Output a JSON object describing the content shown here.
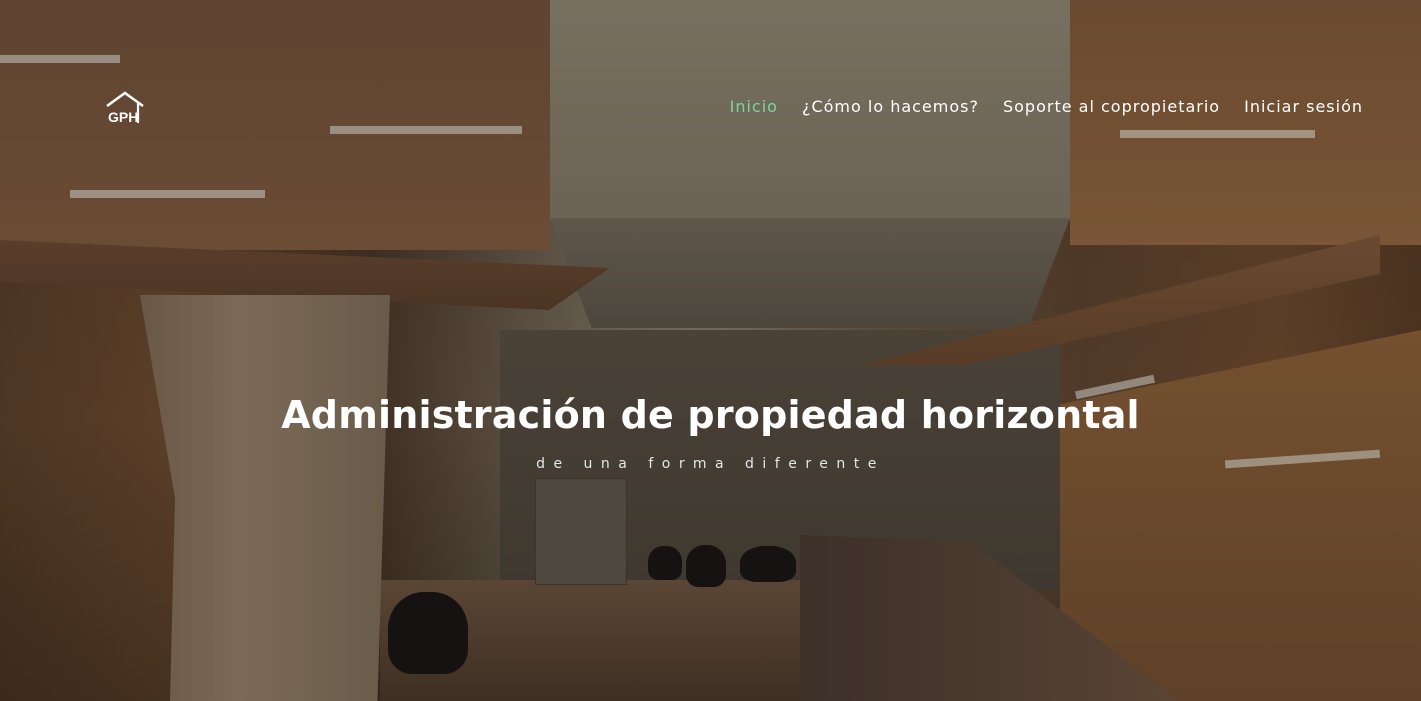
{
  "brand": {
    "logo_text": "GPH",
    "logo_icon": "house-roof-icon"
  },
  "nav": {
    "items": [
      {
        "label": "Inicio",
        "active": true
      },
      {
        "label": "¿Cómo lo hacemos?",
        "active": false
      },
      {
        "label": "Soporte al copropietario",
        "active": false
      },
      {
        "label": "Iniciar sesión",
        "active": false
      }
    ]
  },
  "hero": {
    "title": "Administración de propiedad horizontal",
    "subtitle": "de una forma diferente"
  },
  "colors": {
    "accent": "#7ed3a2",
    "text": "#ffffff"
  }
}
